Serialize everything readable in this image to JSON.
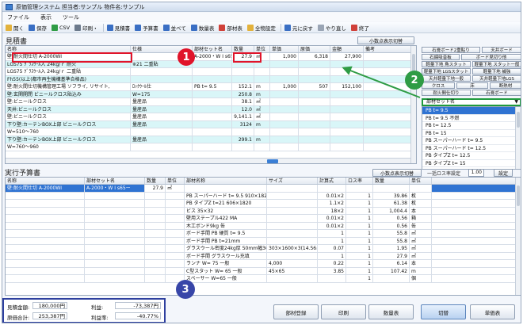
{
  "window": {
    "title": "原価管理システム 担当者:サンプル 物件名:サンプル"
  },
  "menu": [
    "ファイル",
    "表示",
    "ツール"
  ],
  "toolbar": [
    {
      "label": "開く",
      "icon": "folder-icon",
      "color": "#e3b23c"
    },
    {
      "label": "保存",
      "icon": "save-icon",
      "color": "#3a6fc4"
    },
    {
      "label": "CSV",
      "icon": "csv-icon",
      "color": "#2f9c45"
    },
    {
      "label": "印刷・",
      "icon": "print-icon",
      "color": "#6c7a8c"
    },
    {
      "label": "見積書",
      "icon": "estimate-icon",
      "color": "#3a6fc4"
    },
    {
      "label": "予算書",
      "icon": "budget-icon",
      "color": "#3a6fc4"
    },
    {
      "label": "並べて",
      "icon": "tile-icon",
      "color": "#3a6fc4"
    },
    {
      "label": "数量表",
      "icon": "quantity-icon",
      "color": "#3a6fc4"
    },
    {
      "label": "部材表",
      "icon": "parts-icon",
      "color": "#d0413a"
    },
    {
      "label": "全物設定",
      "icon": "settings-icon",
      "color": "#e3b23c"
    },
    {
      "label": "元に戻す",
      "icon": "undo-icon",
      "color": "#3a6fc4"
    },
    {
      "label": "やり直し",
      "icon": "redo-icon",
      "color": "#9aa5b5"
    },
    {
      "label": "終了",
      "icon": "exit-icon",
      "color": "#d0413a"
    }
  ],
  "estimate": {
    "section_label": "見積書",
    "decimal_button": "小数点表示切替",
    "columns": [
      "名称",
      "仕様",
      "部材セット名",
      "数量",
      "単位",
      "単価",
      "原価",
      "金額",
      "備考"
    ],
    "rows": [
      {
        "name": "壁:耐火間仕切 A-2000WI",
        "spec": "",
        "set": "A-2000・W I s65ー",
        "qty": "27.9",
        "unit": "㎡",
        "price": "1,000",
        "cost": "6,318",
        "amount": "27,900",
        "note": ""
      },
      {
        "name": "LGS75 ｸﾞﾗｽｳｰﾙ入 24kg/ｒ 耐火",
        "spec": "※21 二重貼",
        "set": "",
        "qty": "",
        "unit": "",
        "price": "",
        "cost": "",
        "amount": "",
        "note": ""
      },
      {
        "name": "LGS75 ｸﾞﾗｽｳｰﾙ入 24kg/ｒ 二重貼",
        "spec": "",
        "set": "",
        "qty": "",
        "unit": "",
        "price": "",
        "cost": "",
        "amount": "",
        "note": ""
      },
      {
        "name": "Fh55(以上(都市再生機構基準合格品)",
        "spec": "",
        "set": "",
        "qty": "",
        "unit": "",
        "price": "",
        "cost": "",
        "amount": "",
        "note": ""
      },
      {
        "name": "壁:耐火間仕切機構管理工場 ソフライ, リサイト,",
        "spec": "ﾛｯｸｳｰﾙ仕",
        "set": "PB t= 9.5",
        "qty": "152.1",
        "unit": "m",
        "price": "1,000",
        "cost": "507",
        "amount": "152,100",
        "note": ""
      },
      {
        "name": "壁:玄関開閉 ビニールクロス貼込み",
        "spec": "W=175",
        "set": "",
        "qty": "250.8",
        "unit": "m",
        "price": "",
        "cost": "",
        "amount": "",
        "note": ""
      },
      {
        "name": "壁:ビニールクロス",
        "spec": "量産品",
        "set": "",
        "qty": "38.1",
        "unit": "㎡",
        "price": "",
        "cost": "",
        "amount": "",
        "note": ""
      },
      {
        "name": "天井:ビニールクロス",
        "spec": "量産品",
        "set": "",
        "qty": "12.0",
        "unit": "㎡",
        "price": "",
        "cost": "",
        "amount": "",
        "note": ""
      },
      {
        "name": "壁:ビニールクロス",
        "spec": "量産品",
        "set": "",
        "qty": "9,141.1",
        "unit": "㎡",
        "price": "",
        "cost": "",
        "amount": "",
        "note": ""
      },
      {
        "name": "下り壁:カーテンBOX上部 ビニールクロス",
        "spec": "量産品",
        "set": "",
        "qty": "3124",
        "unit": "m",
        "price": "",
        "cost": "",
        "amount": "",
        "note": ""
      },
      {
        "name": "W=510～760",
        "spec": "",
        "set": "",
        "qty": "",
        "unit": "",
        "price": "",
        "cost": "",
        "amount": "",
        "note": ""
      },
      {
        "name": "下り壁:カーテンBOX上部 ビニールクロス",
        "spec": "量産品",
        "set": "",
        "qty": "299.1",
        "unit": "m",
        "price": "",
        "cost": "",
        "amount": "",
        "note": ""
      },
      {
        "name": "W=760～960",
        "spec": "",
        "set": "",
        "qty": "",
        "unit": "",
        "price": "",
        "cost": "",
        "amount": "",
        "note": ""
      }
    ]
  },
  "right_panel": {
    "categories": [
      "石膏ボード2重貼り",
      "天井ボード",
      "石綿吸音板",
      "ボード見切り他",
      "軽量下地 角スタット",
      "軽量下地 スタット一般",
      "軽量下地 LGSスタット",
      "軽量下地 補強",
      "天井軽量下地一般",
      "天井軽量下地LGS",
      "クロス",
      "床",
      "断熱材",
      "耐火間仕切り",
      "石膏ボード"
    ],
    "combo_value": "部材セット名",
    "list": [
      "PB t= 9.5",
      "PB t= 9.5 不燃",
      "PB t= 12.5",
      "PB t= 15",
      "PB スーパーハード t= 9.5",
      "PB スーパーハード t= 12.5",
      "PB タイプZ t= 12.5",
      "PB タイプZ t= 15"
    ]
  },
  "budget": {
    "section_label": "実行予算書",
    "decimal_button": "小数点表示切替",
    "bulk_label": "一括ロス率設定",
    "bulk_value": "1.00",
    "set_button": "設定",
    "left_columns": [
      "名称",
      "部材セット名",
      "数量",
      "単位"
    ],
    "right_columns": [
      "部材名称",
      "サイズ",
      "計算式",
      "ロス率",
      "数量",
      "単位"
    ],
    "rows": [
      {
        "name": "壁:耐火間仕切 A-2000WI",
        "set": "A-2000・W I s65ー",
        "qty": "27.9",
        "unit": "㎡",
        "part": "",
        "size": "",
        "calc": "",
        "loss": "",
        "pqty": "",
        "punit": ""
      },
      {
        "name": "",
        "set": "",
        "qty": "",
        "unit": "",
        "part": "PB スーパーハード t= 9.5 910×1820",
        "size": "",
        "calc": "0.01×2",
        "loss": "1",
        "pqty": "39.86",
        "punit": "枚"
      },
      {
        "name": "",
        "set": "",
        "qty": "",
        "unit": "",
        "part": "PB タイプZ t=21 606×1820",
        "size": "",
        "calc": "1.1×2",
        "loss": "1",
        "pqty": "61.38",
        "punit": "枚"
      },
      {
        "name": "",
        "set": "",
        "qty": "",
        "unit": "",
        "part": "ビス 35×32",
        "size": "",
        "calc": "18×2",
        "loss": "1",
        "pqty": "1,004.4",
        "punit": "本"
      },
      {
        "name": "",
        "set": "",
        "qty": "",
        "unit": "",
        "part": "壁用ステープル422 MA",
        "size": "",
        "calc": "0.01×2",
        "loss": "1",
        "pqty": "0.56",
        "punit": "箱"
      },
      {
        "name": "",
        "set": "",
        "qty": "",
        "unit": "",
        "part": "木工ボンド9kg 缶",
        "size": "",
        "calc": "0.01×2",
        "loss": "1",
        "pqty": "0.56",
        "punit": "缶"
      },
      {
        "name": "",
        "set": "",
        "qty": "",
        "unit": "",
        "part": "ボード手間 PB 硬質 t= 9.5",
        "size": "",
        "calc": "1",
        "loss": "1",
        "pqty": "55.8",
        "punit": "㎡"
      },
      {
        "name": "",
        "set": "",
        "qty": "",
        "unit": "",
        "part": "ボード手間 PB t=21mm",
        "size": "",
        "calc": "1",
        "loss": "1",
        "pqty": "55.8",
        "punit": "㎡"
      },
      {
        "name": "",
        "set": "",
        "qty": "",
        "unit": "",
        "part": "グラスウール密度24kg厚 50mm幅303",
        "size": "303×1600×3(14.56㎡",
        "calc": "0.07",
        "loss": "1",
        "pqty": "1.95",
        "punit": "㎡"
      },
      {
        "name": "",
        "set": "",
        "qty": "",
        "unit": "",
        "part": "ボード手間 グラスウール充填",
        "size": "",
        "calc": "1",
        "loss": "1",
        "pqty": "27.9",
        "punit": "㎡"
      },
      {
        "name": "",
        "set": "",
        "qty": "",
        "unit": "",
        "part": "ランナ W= 75 一般",
        "size": "4,000",
        "calc": "0.22",
        "loss": "1",
        "pqty": "6.14",
        "punit": "本"
      },
      {
        "name": "",
        "set": "",
        "qty": "",
        "unit": "",
        "part": "C型スタット W= 65 一般",
        "size": "45×65",
        "calc": "3.85",
        "loss": "1",
        "pqty": "107.42",
        "punit": "m"
      },
      {
        "name": "",
        "set": "",
        "qty": "",
        "unit": "",
        "part": "スペーサー W=65 一般",
        "size": "",
        "calc": "",
        "loss": "1",
        "pqty": "",
        "punit": "個"
      }
    ]
  },
  "summary": {
    "estimate_total_label": "見積金額:",
    "estimate_total": "180,000円",
    "profit_label": "利益:",
    "profit": "-73,387円",
    "cost_total_label": "原価合計:",
    "cost_total": "253,387円",
    "margin_label": "利益率:",
    "margin": "-40.77%"
  },
  "footer_buttons": [
    "部材登録",
    "印刷",
    "数量表",
    "切替",
    "単価表"
  ],
  "annotations": [
    "1",
    "2",
    "3"
  ],
  "colors": {
    "badge_red": "#e0142a",
    "badge_green": "#2f9c45",
    "badge_blue": "#3846a8",
    "row_cyan": "#d9f6f8",
    "selection_blue": "#2f73d2"
  }
}
